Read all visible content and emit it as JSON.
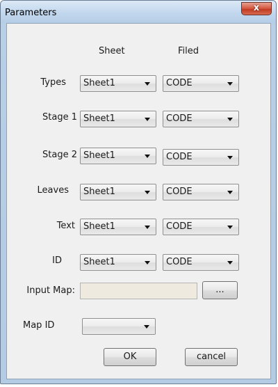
{
  "window": {
    "title": "Parameters",
    "close_label": "x"
  },
  "headers": {
    "sheet": "Sheet",
    "field": "Filed"
  },
  "rows": [
    {
      "label": "Types",
      "sheet": "Sheet1",
      "field": "CODE"
    },
    {
      "label": "Stage 1",
      "sheet": "Sheet1",
      "field": "CODE"
    },
    {
      "label": "Stage 2",
      "sheet": "Sheet1",
      "field": "CODE"
    },
    {
      "label": "Leaves",
      "sheet": "Sheet1",
      "field": "CODE"
    },
    {
      "label": "Text",
      "sheet": "Sheet1",
      "field": "CODE"
    },
    {
      "label": "ID",
      "sheet": "Sheet1",
      "field": "CODE"
    }
  ],
  "input_map": {
    "label": "Input Map:",
    "value": "",
    "browse_label": "..."
  },
  "map_id": {
    "label": "Map ID",
    "value": ""
  },
  "buttons": {
    "ok": "OK",
    "cancel": "cancel"
  }
}
